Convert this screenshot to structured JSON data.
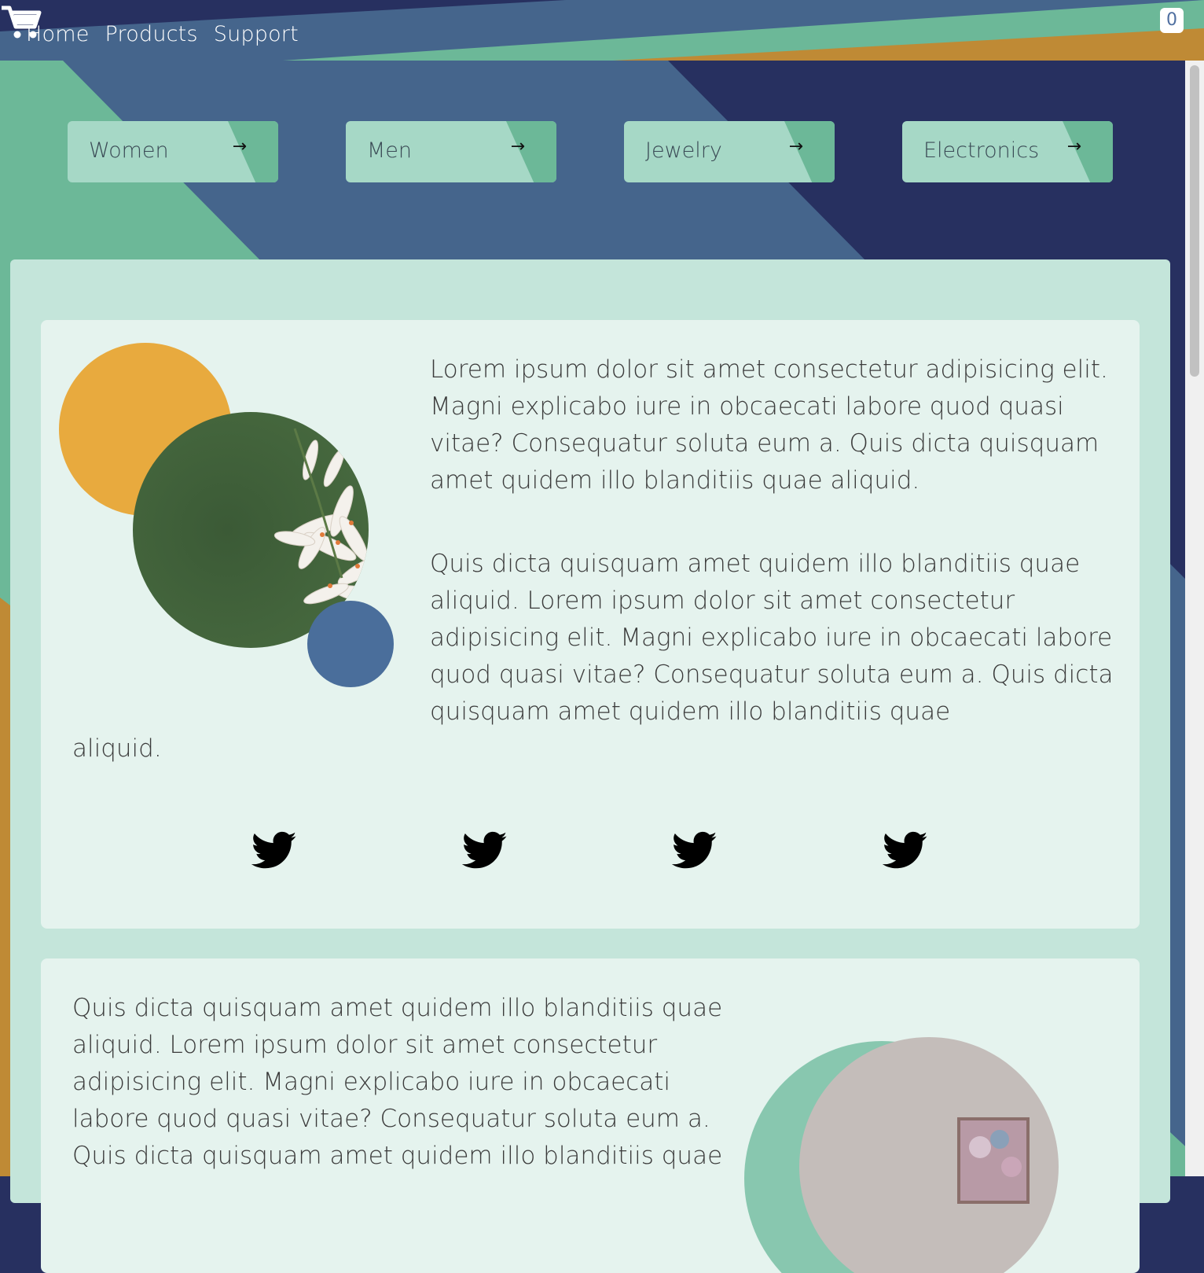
{
  "nav": {
    "items": [
      {
        "label": "Home"
      },
      {
        "label": "Products"
      },
      {
        "label": "Support"
      }
    ]
  },
  "cart": {
    "count": "0",
    "icon": "cart-icon"
  },
  "categories": [
    {
      "label": "Women",
      "icon": "arrow-right-icon"
    },
    {
      "label": "Men",
      "icon": "arrow-right-icon"
    },
    {
      "label": "Jewelry",
      "icon": "arrow-right-icon"
    },
    {
      "label": "Electronics",
      "icon": "arrow-right-icon"
    }
  ],
  "feature1": {
    "para1": "Lorem ipsum dolor sit amet consectetur adipisicing elit. Magni explicabo iure in obcaecati labore quod quasi vitae? Consequatur soluta eum a. Quis dicta quisquam amet quidem illo blanditiis quae aliquid.",
    "para2": "Quis dicta quisquam amet quidem illo blanditiis quae aliquid. Lorem ipsum dolor sit amet consectetur adipisicing elit. Magni explicabo iure in obcaecati labore quod quasi vitae? Consequatur soluta eum a. Quis dicta quisquam amet quidem illo blanditiis quae",
    "para2_tail": "aliquid.",
    "social_icons": [
      "twitter-icon",
      "twitter-icon",
      "twitter-icon",
      "twitter-icon"
    ]
  },
  "feature2": {
    "para1": "Quis dicta quisquam amet quidem illo blanditiis quae aliquid. Lorem ipsum dolor sit amet consectetur adipisicing elit. Magni explicabo iure in obcaecati labore quod quasi vitae? Consequatur soluta eum a. Quis dicta quisquam amet quidem illo blanditiis quae"
  },
  "colors": {
    "navy": "#273060",
    "steel_blue": "#45658c",
    "mint": "#6cb898",
    "gold": "#bf8a35",
    "panel": "#c4e5da",
    "card": "#e5f3ee"
  }
}
